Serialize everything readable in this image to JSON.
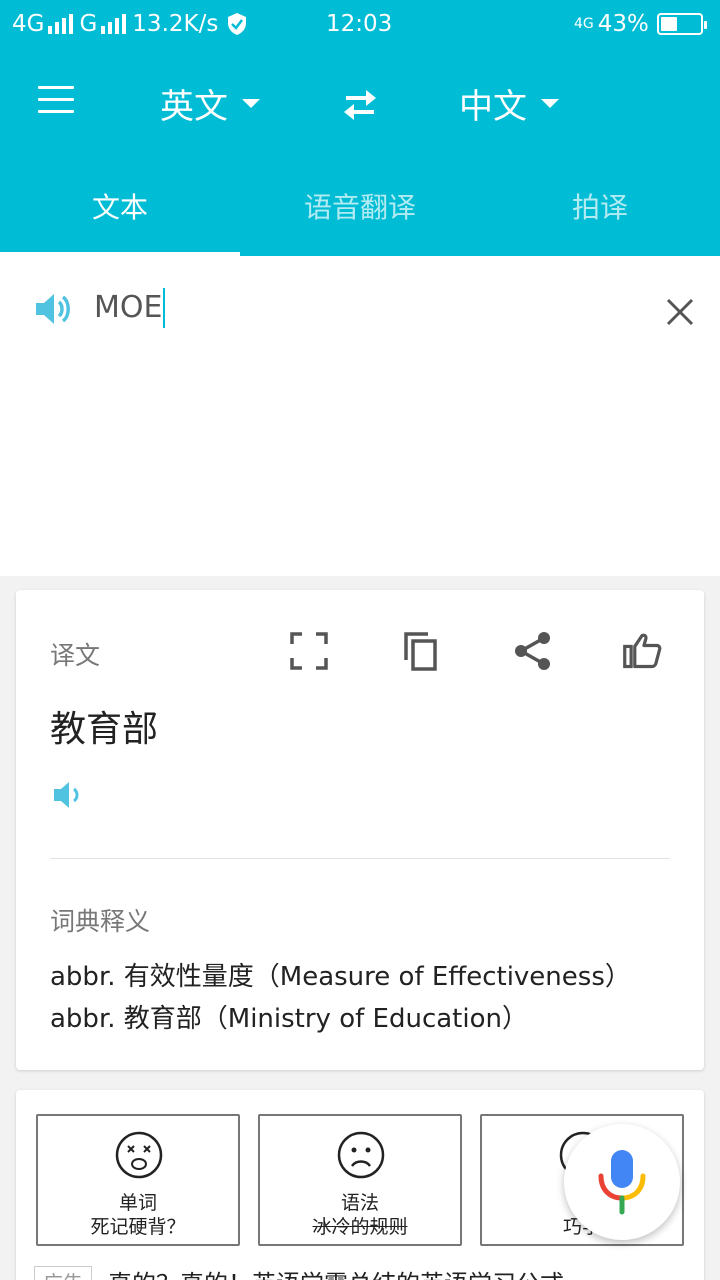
{
  "status_bar": {
    "network_1": "4G",
    "network_2": "G",
    "speed": "13.2K/s",
    "time": "12:03",
    "network_right": "4G",
    "battery": "43%",
    "battery_level": 0.43
  },
  "toolbar": {
    "source_lang": "英文",
    "target_lang": "中文"
  },
  "tabs": [
    {
      "label": "文本",
      "active": true
    },
    {
      "label": "语音翻译",
      "active": false
    },
    {
      "label": "拍译",
      "active": false
    }
  ],
  "input": {
    "text": "MOE"
  },
  "result_card": {
    "label": "译文",
    "translation": "教育部",
    "dict_label": "词典释义",
    "dict_lines": [
      "abbr. 有效性量度（Measure of Effectiveness）",
      "abbr. 教育部（Ministry of Education）"
    ]
  },
  "ad": {
    "thumbs": [
      {
        "line1": "单词",
        "line2": "死记硬背？"
      },
      {
        "line1": "语法",
        "line2": "冰冷的规则"
      },
      {
        "line1": "",
        "line2": "巧学"
      }
    ],
    "tag": "广告",
    "text": "真的？真的！英语学霸总结的英语学习公式"
  },
  "colors": {
    "accent": "#00bcd4",
    "speaker": "#4fc3e0"
  }
}
